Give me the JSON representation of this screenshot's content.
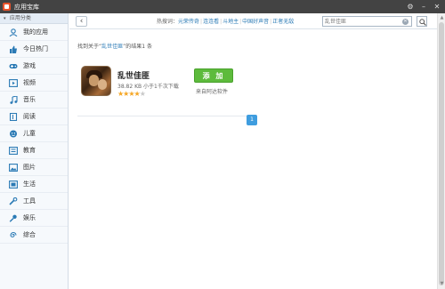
{
  "window": {
    "title": "应用宝库",
    "controls": [
      "⚙",
      "–",
      "✕"
    ]
  },
  "sidebar": {
    "header": "应用分类",
    "items": [
      {
        "label": "我的应用",
        "icon": "person-icon"
      },
      {
        "label": "今日热门",
        "icon": "thumbs-up-icon"
      },
      {
        "label": "游戏",
        "icon": "gamepad-icon"
      },
      {
        "label": "视频",
        "icon": "video-icon"
      },
      {
        "label": "音乐",
        "icon": "music-note-icon"
      },
      {
        "label": "阅读",
        "icon": "book-icon"
      },
      {
        "label": "儿童",
        "icon": "child-face-icon"
      },
      {
        "label": "教育",
        "icon": "education-icon"
      },
      {
        "label": "图片",
        "icon": "image-icon"
      },
      {
        "label": "生活",
        "icon": "life-icon"
      },
      {
        "label": "工具",
        "icon": "tool-icon"
      },
      {
        "label": "娱乐",
        "icon": "microphone-icon"
      },
      {
        "label": "综合",
        "icon": "swirl-icon"
      }
    ]
  },
  "topbar": {
    "back": "‹",
    "hot_label": "热搜词：",
    "hot_keywords": [
      "元荣传奇",
      "连连看",
      "斗地主",
      "中国好声音",
      "正者无敌"
    ],
    "search_placeholder": "乱世佳匪"
  },
  "results": {
    "prefix": "找到关于“",
    "query": "乱世佳匪",
    "suffix": "”的结果1 条"
  },
  "app": {
    "name": "乱世佳匪",
    "meta": "38.82 KB 小于1千次下载",
    "rating": 4,
    "rating_max": 5,
    "add_label": "添 加",
    "source": "来自阿达软件"
  },
  "pagination": {
    "current": "1"
  },
  "colors": {
    "accent": "#3f9ddf",
    "add_button": "#5dbb3c",
    "titlebar": "#434343",
    "star": "#f5a623"
  }
}
